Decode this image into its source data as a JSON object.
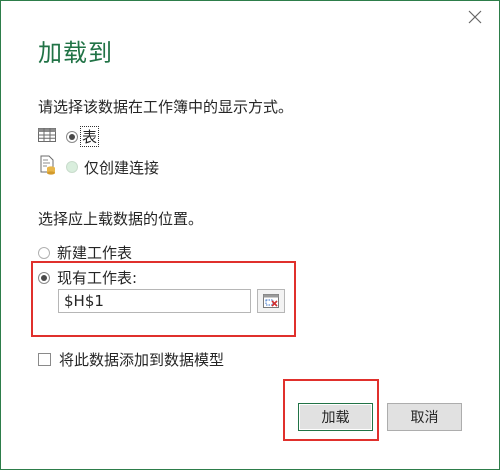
{
  "dialog": {
    "title": "加载到",
    "close_icon": "close-icon"
  },
  "display_section": {
    "prompt": "请选择该数据在工作簿中的显示方式。",
    "options": [
      {
        "label": "表",
        "icon": "table-icon",
        "selected": true,
        "enabled": true
      },
      {
        "label": "仅创建连接",
        "icon": "connection-only-icon",
        "selected": false,
        "enabled": false
      }
    ]
  },
  "location_section": {
    "prompt": "选择应上载数据的位置。",
    "options": [
      {
        "label": "新建工作表",
        "selected": false
      },
      {
        "label": "现有工作表:",
        "selected": true
      }
    ],
    "cell_reference": "$H$1",
    "ref_button_icon": "range-select-icon"
  },
  "data_model": {
    "label": "将此数据添加到数据模型",
    "checked": false
  },
  "buttons": {
    "load_label": "加载",
    "cancel_label": "取消"
  },
  "colors": {
    "accent": "#217346",
    "highlight": "#e0302c"
  }
}
